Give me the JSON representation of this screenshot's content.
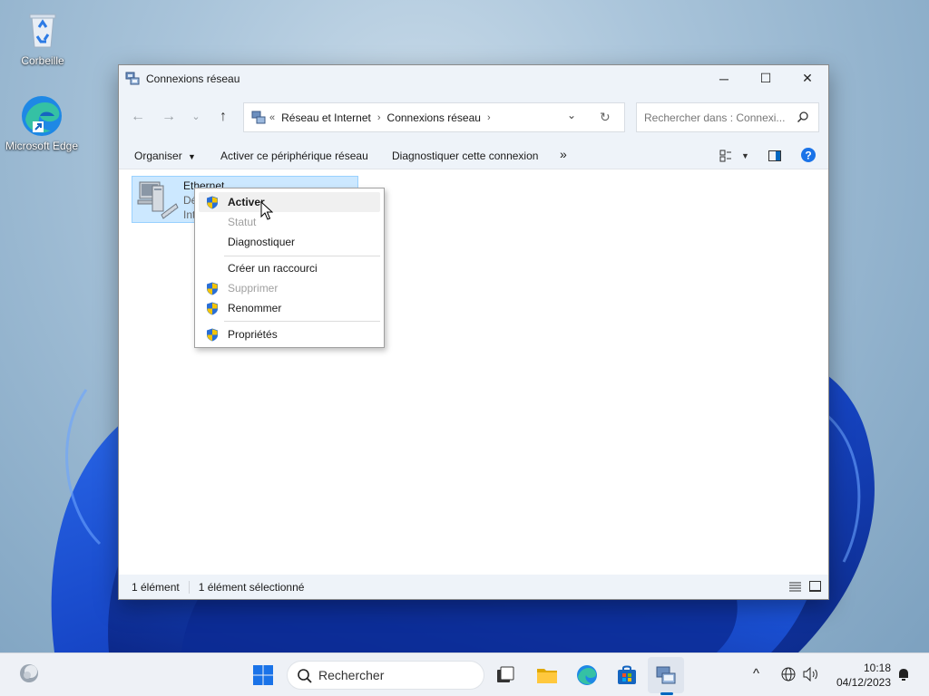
{
  "desktop": {
    "icons": [
      {
        "label": "Corbeille"
      },
      {
        "label": "Microsoft Edge"
      }
    ]
  },
  "window": {
    "title": "Connexions réseau",
    "controls": {
      "minimize": "─",
      "maximize": "☐",
      "close": "✕"
    }
  },
  "address_bar": {
    "overflow": "«",
    "segments": [
      "Réseau et Internet",
      "Connexions réseau"
    ]
  },
  "search": {
    "placeholder": "Rechercher dans : Connexi..."
  },
  "toolbar": {
    "organize": "Organiser",
    "activate_device": "Activer ce périphérique réseau",
    "diagnose": "Diagnostiquer cette connexion",
    "more": "»"
  },
  "network_item": {
    "name": "Ethernet",
    "line2": "Dé",
    "line3": "Int"
  },
  "context_menu": {
    "items": [
      {
        "label": "Activer",
        "shield": true,
        "bold": true,
        "disabled": false
      },
      {
        "label": "Statut",
        "shield": false,
        "bold": false,
        "disabled": true
      },
      {
        "label": "Diagnostiquer",
        "shield": false,
        "bold": false,
        "disabled": false
      },
      {
        "label": "Créer un raccourci",
        "shield": false,
        "bold": false,
        "disabled": false
      },
      {
        "label": "Supprimer",
        "shield": true,
        "bold": false,
        "disabled": true
      },
      {
        "label": "Renommer",
        "shield": true,
        "bold": false,
        "disabled": false
      },
      {
        "label": "Propriétés",
        "shield": true,
        "bold": false,
        "disabled": false
      }
    ]
  },
  "statusbar": {
    "count": "1 élément",
    "selected": "1 élément sélectionné"
  },
  "taskbar": {
    "search_label": "Rechercher",
    "time": "10:18",
    "date": "04/12/2023"
  },
  "colors": {
    "accent": "#0067c0",
    "selection": "#cce8ff",
    "shield_blue": "#2a6fd6",
    "shield_yellow": "#f5c400"
  }
}
